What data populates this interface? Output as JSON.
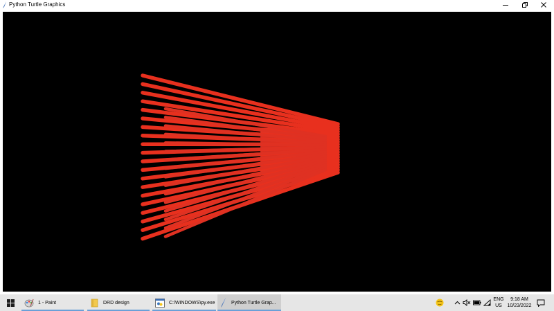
{
  "window": {
    "title": "Python Turtle Graphics"
  },
  "canvas": {
    "background": "#000000",
    "stroke_color": "#e8301e",
    "fill_color": "#e03426"
  },
  "taskbar": {
    "items": [
      {
        "label": "1 - Paint",
        "icon": "paint-icon"
      },
      {
        "label": "DRD design",
        "icon": "folder-icon"
      },
      {
        "label": "C:\\WINDOWS\\py.exe",
        "icon": "python-console-icon"
      },
      {
        "label": "Python Turtle Grap...",
        "icon": "turtle-feather-icon"
      }
    ],
    "lang_top": "ENG",
    "lang_bottom": "US",
    "time": "9:18 AM",
    "date": "10/23/2022"
  },
  "colors": {
    "taskbar_bg": "#e6e6e6",
    "accent": "#6aa0d8"
  }
}
